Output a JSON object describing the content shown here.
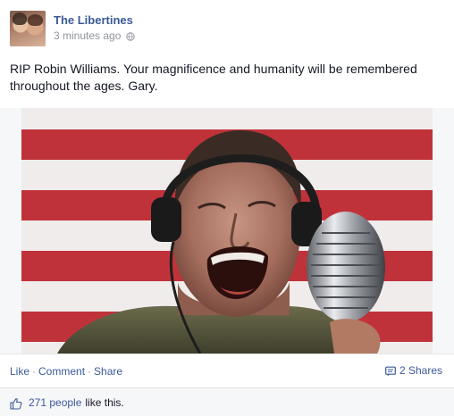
{
  "post": {
    "author": "The Libertines",
    "timestamp": "3 minutes ago",
    "privacy_icon": "globe-icon",
    "text": "RIP Robin Williams. Your magnificence and humanity will be remembered throughout the ages. Gary."
  },
  "photo": {
    "icon": "photo",
    "colors": {
      "stripe_red": "#c0323a",
      "stripe_white": "#efeceb"
    }
  },
  "actions": {
    "like": "Like",
    "comment": "Comment",
    "share": "Share",
    "separator": "·",
    "shares_count": "2 Shares",
    "shares_icon": "shares-icon"
  },
  "likes": {
    "count": "271 people",
    "suffix": "like this.",
    "icon": "thumbs-up-icon"
  },
  "colors": {
    "link": "#3b5998",
    "muted": "#90949c",
    "text": "#141823"
  }
}
